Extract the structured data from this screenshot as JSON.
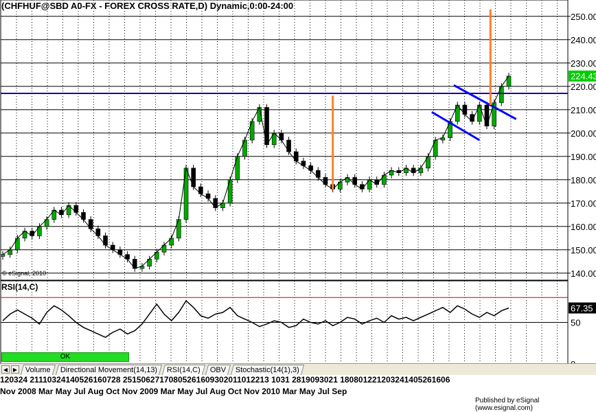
{
  "chart_data": [
    {
      "type": "line",
      "title": "(CHFHUF@SBD A0-FX - FOREX CROSS RATE,D) Dynamic,0:00-24:00",
      "chart_style": "candlestick",
      "ylim": [
        137,
        257
      ],
      "y_ticks": [
        "140.00",
        "150.00",
        "160.00",
        "170.00",
        "180.00",
        "190.00",
        "200.00",
        "210.00",
        "220.00",
        "230.00",
        "240.00",
        "250.00"
      ],
      "last_price_label": "224.43",
      "last_price_color": "#00cc00",
      "watermark": "© eSignal, 2010",
      "series": [
        {
          "values": [
            148,
            150,
            155,
            158,
            156,
            160,
            163,
            167,
            165,
            169,
            166,
            163,
            159,
            156,
            152,
            150,
            148,
            146,
            142,
            143,
            146,
            149,
            152,
            155,
            163,
            185,
            177,
            174,
            172,
            168,
            170,
            180,
            190,
            197,
            205,
            211,
            195,
            200,
            197,
            192,
            188,
            186,
            184,
            181,
            178,
            176,
            179,
            181,
            178,
            176,
            180,
            178,
            182,
            184,
            183,
            185,
            183,
            185,
            190,
            197,
            198,
            205,
            212,
            208,
            205,
            212,
            203,
            213,
            220,
            224.43
          ]
        }
      ],
      "overlays": {
        "horizontal_lines": [
          {
            "y": 217,
            "color": "#1a0099"
          }
        ],
        "trend_lines": [
          {
            "x0": 61.5,
            "y0": 220.5,
            "x1": 70,
            "y1": 206,
            "color": "#0000ff"
          },
          {
            "x0": 58.5,
            "y0": 209,
            "x1": 65,
            "y1": 197,
            "color": "#0000ff"
          }
        ],
        "vertical_markers": [
          {
            "x": 45,
            "y0": 176,
            "y1": 216,
            "color": "#ff7f27"
          },
          {
            "x": 66.5,
            "y0": 212,
            "y1": 253,
            "color": "#ff7f27"
          }
        ]
      }
    },
    {
      "type": "line",
      "title": "RSI(14,C)",
      "ylim": [
        0,
        100
      ],
      "y_ticks": [
        "0",
        "50"
      ],
      "overbought": 80,
      "last_value_label": "67.35",
      "series": [
        {
          "values": [
            52,
            60,
            65,
            60,
            55,
            48,
            62,
            70,
            65,
            58,
            50,
            44,
            40,
            36,
            32,
            38,
            42,
            36,
            40,
            48,
            60,
            72,
            60,
            52,
            62,
            76,
            68,
            58,
            55,
            60,
            62,
            68,
            58,
            54,
            50,
            45,
            48,
            52,
            50,
            44,
            46,
            54,
            50,
            48,
            52,
            46,
            50,
            56,
            54,
            48,
            52,
            55,
            50,
            58,
            54,
            56,
            52,
            56,
            60,
            64,
            68,
            62,
            70,
            66,
            60,
            56,
            62,
            58,
            64,
            67.35
          ]
        }
      ]
    }
  ],
  "status_bar": {
    "label": "OK"
  },
  "tabs": {
    "items": [
      "Volume",
      "Directional Movement(14,13)",
      "RSI(14,C)",
      "OBV",
      "Stochastic(14(1),3)"
    ],
    "active": "RSI(14,C)"
  },
  "x_axis": {
    "day_labels": "120324 21110324140526160728 25150627170805261609302011012213 1031 2819093021 180801221203241405261606",
    "month_labels": "Nov    2008      Mar      May      Jul Aug    Oct Nov    2009     Mar      May      Jul Aug    Oct Nov     2010     Mar      May      Jul      Sep"
  },
  "footer": {
    "publisher": "Published by eSignal (www.esignal.com)"
  },
  "colors": {
    "up_candle": "#00aa00",
    "down_candle": "#000000",
    "grid": "#000000",
    "panel_border": "#000000",
    "rsi_line": "#000000",
    "rsi_overbought": "#cc0000"
  }
}
